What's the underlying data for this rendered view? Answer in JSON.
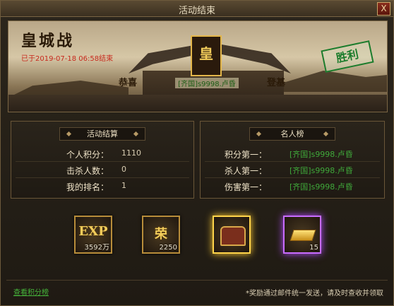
{
  "window": {
    "title": "活动结束",
    "close_label": "X"
  },
  "banner": {
    "event_title": "皇城战",
    "end_time": "已于2019-07-18 06:58结束",
    "emblem_text": "皇",
    "couplet_left": "恭喜",
    "couplet_right": "登基",
    "winner": "[齐国]s9998.卢昏",
    "victory_stamp": "胜利"
  },
  "activity_panel": {
    "title": "活动结算",
    "rows": [
      {
        "label": "个人积分：",
        "value": "1110"
      },
      {
        "label": "击杀人数：",
        "value": "0"
      },
      {
        "label": "我的排名：",
        "value": "1"
      }
    ]
  },
  "hall_of_fame": {
    "title": "名人榜",
    "rows": [
      {
        "label": "积分第一：",
        "value": "[齐国]s9998.卢昏"
      },
      {
        "label": "杀人第一：",
        "value": "[齐国]s9998.卢昏"
      },
      {
        "label": "伤害第一：",
        "value": "[齐国]s9998.卢昏"
      }
    ]
  },
  "rewards": [
    {
      "icon": "exp-scroll-icon",
      "label": "EXP",
      "quantity": "3592万",
      "rarity_color": "#b88d3a"
    },
    {
      "icon": "rong-token-icon",
      "label": "荣",
      "quantity": "2250",
      "rarity_color": "#b88d3a"
    },
    {
      "icon": "treasure-chest-icon",
      "label": "",
      "quantity": "",
      "rarity_color": "#ffd44a"
    },
    {
      "icon": "gold-bar-icon",
      "label": "",
      "quantity": "15",
      "rarity_color": "#c86cff"
    }
  ],
  "footer": {
    "link_text": "查看积分榜",
    "note": "*奖励通过邮件统一发送，请及时查收并领取"
  }
}
